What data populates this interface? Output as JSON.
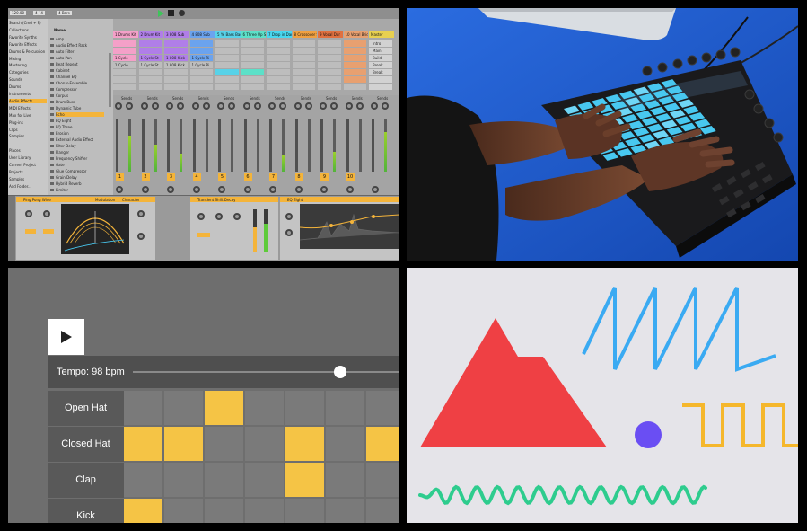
{
  "daw": {
    "browser_items": [
      "Search (Cmd + F)",
      "Collections",
      "Favorite Synths",
      "Favorite Effects",
      "Drums & Percussion",
      "Mixing",
      "Mastering",
      "Categories",
      "Sounds",
      "Drums",
      "Instruments",
      "Audio Effects",
      "MIDI Effects",
      "Max for Live",
      "Plug-ins",
      "Clips",
      "Samples",
      "",
      "Places",
      "User Library",
      "Current Project",
      "Projects",
      "Samples",
      "Add Folder..."
    ],
    "file_column_header": "Name",
    "file_items": [
      "Amp",
      "Audio Effect Rack",
      "Auto Filter",
      "Auto Pan",
      "Beat Repeat",
      "Cabinet",
      "Channel EQ",
      "Chorus-Ensemble",
      "Compressor",
      "Corpus",
      "Drum Buss",
      "Dynamic Tube",
      "Echo",
      "EQ Eight",
      "EQ Three",
      "Erosion",
      "External Audio Effect",
      "Filter Delay",
      "Flanger",
      "Frequency Shifter",
      "Gate",
      "Glue Compressor",
      "Grain Delay",
      "Hybrid Reverb",
      "Limiter"
    ],
    "tracks": [
      {
        "name": "1 Drums Kit",
        "color": "#f4a0c8"
      },
      {
        "name": "2 Drum Kit",
        "color": "#b07ee8"
      },
      {
        "name": "3 808 Sub",
        "color": "#b07ee8"
      },
      {
        "name": "4 808 Sub",
        "color": "#6ba3ee"
      },
      {
        "name": "5 Ye Bass Bass",
        "color": "#58d2e8"
      },
      {
        "name": "6 Three Up Se",
        "color": "#5ce0c8"
      },
      {
        "name": "7 Drop in Dark",
        "color": "#48d7f0"
      },
      {
        "name": "8 Crossover Se",
        "color": "#f0a040"
      },
      {
        "name": "9 Vocal Dur",
        "color": "#e07040"
      },
      {
        "name": "10 Vocal Bridge",
        "color": "#e8a070"
      },
      {
        "name": "Master",
        "color": "#e8d050"
      }
    ],
    "clips": [
      "1 Cycle",
      "1 Cycle St",
      "1 808 Kick",
      "1 Cycle Ri"
    ],
    "right_column": [
      "Intro",
      "Main",
      "Build",
      "Break",
      "Break"
    ],
    "track_numbers": [
      "1",
      "2",
      "3",
      "4",
      "5",
      "6",
      "7",
      "8",
      "9",
      "10"
    ],
    "send_label": "Sends",
    "device_chain": {
      "device1": "Ping Pong Wide",
      "tab_modulation": "Modulation",
      "tab_character": "Character",
      "device2": "Transient Shift Decay",
      "device3": "EQ Eight"
    },
    "header_controls": [
      "120.00",
      "4 / 4",
      "4 Bars"
    ]
  },
  "sequencer": {
    "play_icon": "play-icon",
    "tempo_label": "Tempo: 98 bpm",
    "tempo_value_bpm": 98,
    "tempo_slider_fraction": 0.82,
    "rows": [
      {
        "label": "Open Hat",
        "steps": [
          0,
          0,
          1,
          0,
          0,
          0,
          0
        ]
      },
      {
        "label": "Closed Hat",
        "steps": [
          1,
          1,
          0,
          0,
          1,
          0,
          1
        ]
      },
      {
        "label": "Clap",
        "steps": [
          0,
          0,
          0,
          0,
          1,
          0,
          0
        ]
      },
      {
        "label": "Kick",
        "steps": [
          1,
          0,
          0,
          0,
          0,
          0,
          0
        ]
      }
    ],
    "colors": {
      "active": "#f5c445",
      "inactive": "#7a7a7a",
      "background": "#6e6e6e",
      "label_bg": "#595959",
      "track_bar": "#4f4f4f"
    }
  },
  "shapes": {
    "triangle_color": "#ef4044",
    "circle_color": "#6a4ef3",
    "sawtooth_color": "#3aaaf2",
    "square_wave_color": "#f5b72c",
    "sine_color": "#2ecc8e",
    "background": "#e5e4e9"
  },
  "photo": {
    "subject": "Hands playing a pad grid controller on a blue table",
    "table_color": "#1f5dd0",
    "pad_color": "#48c8f0"
  }
}
